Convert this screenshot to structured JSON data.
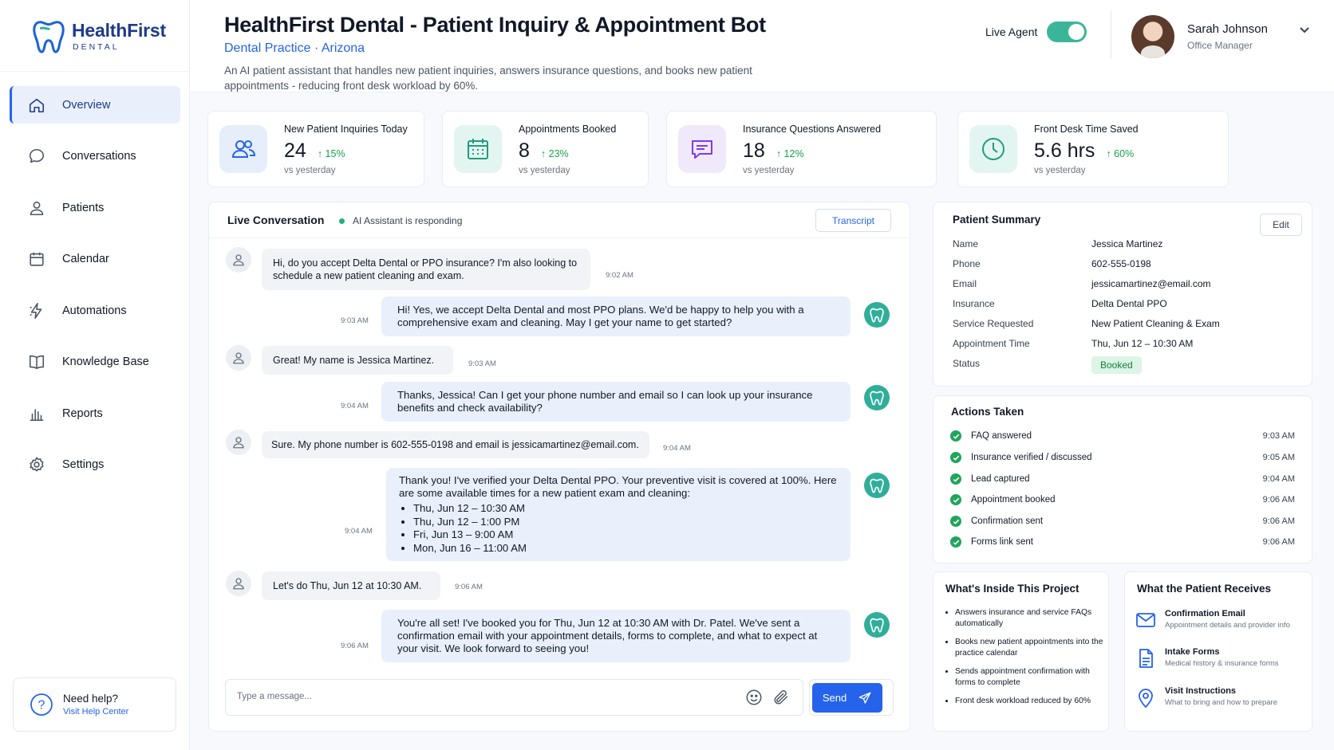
{
  "brand": {
    "name": "HealthFirst",
    "sub": "DENTAL"
  },
  "sidebar": {
    "items": [
      {
        "label": "Overview",
        "icon": "home-icon",
        "active": true
      },
      {
        "label": "Conversations",
        "icon": "chat-bubble-icon"
      },
      {
        "label": "Patients",
        "icon": "user-icon"
      },
      {
        "label": "Calendar",
        "icon": "calendar-icon"
      },
      {
        "label": "Automations",
        "icon": "lightning-icon"
      },
      {
        "label": "Knowledge Base",
        "icon": "book-icon"
      },
      {
        "label": "Reports",
        "icon": "bar-chart-icon"
      },
      {
        "label": "Settings",
        "icon": "gear-icon"
      }
    ],
    "help": {
      "title": "Need help?",
      "link": "Visit Help Center"
    }
  },
  "header": {
    "title": "HealthFirst Dental - Patient Inquiry & Appointment Bot",
    "subtitle": "Dental Practice · Arizona",
    "description": "An AI patient assistant that handles new patient inquiries, answers insurance questions, and books new patient appointments - reducing front desk workload by 60%.",
    "live_agent_label": "Live Agent",
    "live_agent_on": true,
    "user": {
      "name": "Sarah Johnson",
      "role": "Office Manager"
    }
  },
  "stats": [
    {
      "label": "New Patient Inquiries Today",
      "value": "24",
      "delta": "15%",
      "sub": "vs yesterday",
      "icon": "users-icon",
      "bg": "#e6eefc",
      "color": "#2563eb"
    },
    {
      "label": "Appointments Booked",
      "value": "8",
      "delta": "23%",
      "sub": "vs yesterday",
      "icon": "calendar-icon",
      "bg": "#e3f5f0",
      "color": "#1f9c7f"
    },
    {
      "label": "Insurance Questions Answered",
      "value": "18",
      "delta": "12%",
      "sub": "vs yesterday",
      "icon": "message-icon",
      "bg": "#efe9fb",
      "color": "#7c3aed"
    },
    {
      "label": "Front Desk Time Saved",
      "value": "5.6 hrs",
      "delta": "60%",
      "sub": "vs yesterday",
      "icon": "clock-icon",
      "bg": "#e3f5f0",
      "color": "#1f9c7f"
    }
  ],
  "conversation": {
    "title": "Live Conversation",
    "status": "AI Assistant is responding",
    "transcript_label": "Transcript",
    "messages": [
      {
        "from": "patient",
        "text": "Hi, do you accept Delta Dental or PPO insurance? I'm also looking to schedule a new patient cleaning and exam.",
        "time": "9:02 AM"
      },
      {
        "from": "bot",
        "text": "Hi! Yes, we accept Delta Dental and most PPO plans. We'd be happy to help you with a comprehensive exam and cleaning. May I get your name to get started?",
        "time": "9:03 AM"
      },
      {
        "from": "patient",
        "text": "Great! My name is Jessica Martinez.",
        "time": "9:03 AM"
      },
      {
        "from": "bot",
        "text": "Thanks, Jessica! Can I get your phone number and email so I can look up your insurance benefits and check availability?",
        "time": "9:04 AM"
      },
      {
        "from": "patient",
        "text": "Sure. My phone number is 602-555-0198 and email is jessicamartinez@email.com.",
        "time": "9:04 AM"
      },
      {
        "from": "bot",
        "text": "Thank you! I've verified your Delta Dental PPO. Your preventive visit is covered at 100%. Here are some available times for a new patient exam and cleaning:",
        "time": "9:04 AM",
        "list": [
          "Thu, Jun 12 – 10:30 AM",
          "Thu, Jun 12 – 1:00 PM",
          "Fri, Jun 13 – 9:00 AM",
          "Mon, Jun 16 – 11:00 AM"
        ]
      },
      {
        "from": "patient",
        "text": "Let's do Thu, Jun 12 at 10:30 AM.",
        "time": "9:06 AM"
      },
      {
        "from": "bot",
        "text": "You're all set! I've booked you for Thu, Jun 12 at 10:30 AM with Dr. Patel. We've sent a confirmation email with your appointment details, forms to complete, and what to expect at your visit. We look forward to seeing you!",
        "time": "9:06 AM"
      }
    ],
    "composer_placeholder": "Type a message...",
    "send_label": "Send"
  },
  "patient_summary": {
    "title": "Patient Summary",
    "edit_label": "Edit",
    "fields": [
      {
        "k": "Name",
        "v": "Jessica Martinez"
      },
      {
        "k": "Phone",
        "v": "602-555-0198"
      },
      {
        "k": "Email",
        "v": "jessicamartinez@email.com"
      },
      {
        "k": "Insurance",
        "v": "Delta Dental PPO"
      },
      {
        "k": "Service Requested",
        "v": "New Patient Cleaning & Exam"
      },
      {
        "k": "Appointment Time",
        "v": "Thu, Jun 12 – 10:30 AM"
      }
    ],
    "status_label": "Status",
    "status_value": "Booked"
  },
  "actions": {
    "title": "Actions Taken",
    "items": [
      {
        "label": "FAQ answered",
        "time": "9:03 AM"
      },
      {
        "label": "Insurance verified / discussed",
        "time": "9:05 AM"
      },
      {
        "label": "Lead captured",
        "time": "9:04 AM"
      },
      {
        "label": "Appointment booked",
        "time": "9:06 AM"
      },
      {
        "label": "Confirmation sent",
        "time": "9:06 AM"
      },
      {
        "label": "Forms link sent",
        "time": "9:06 AM"
      }
    ]
  },
  "inside": {
    "title": "What's Inside This Project",
    "items": [
      "Answers insurance and service FAQs automatically",
      "Books new patient appointments into the practice calendar",
      "Sends appointment confirmation with forms to complete",
      "Front desk workload reduced by 60%"
    ]
  },
  "receives": {
    "title": "What the Patient Receives",
    "items": [
      {
        "title": "Confirmation Email",
        "sub": "Appointment details and provider info",
        "icon": "mail-icon"
      },
      {
        "title": "Intake Forms",
        "sub": "Medical history & insurance forms",
        "icon": "document-icon"
      },
      {
        "title": "Visit Instructions",
        "sub": "What to bring and how to prepare",
        "icon": "location-pin-icon"
      }
    ]
  }
}
